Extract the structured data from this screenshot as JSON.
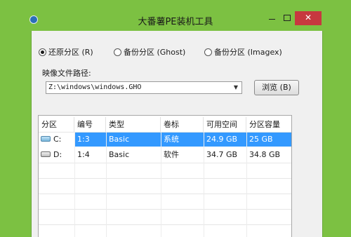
{
  "window": {
    "title": "大番薯PE装机工具",
    "close_glyph": "✕"
  },
  "mode": {
    "options": [
      {
        "label": "还原分区 (R)",
        "checked": true
      },
      {
        "label": "备份分区 (Ghost)",
        "checked": false
      },
      {
        "label": "备份分区 (Imagex)",
        "checked": false
      }
    ]
  },
  "image_path": {
    "label": "映像文件路径:",
    "value": "Z:\\windows\\windows.GHO",
    "browse_label": "浏览 (B)"
  },
  "partitions": {
    "columns": [
      "分区",
      "编号",
      "类型",
      "卷标",
      "可用空间",
      "分区容量"
    ],
    "rows": [
      {
        "drive": "C:",
        "number": "1:3",
        "type": "Basic",
        "label": "系统",
        "free": "24.9 GB",
        "capacity": "25 GB",
        "selected": true,
        "icon": "system-disk-icon"
      },
      {
        "drive": "D:",
        "number": "1:4",
        "type": "Basic",
        "label": "软件",
        "free": "34.7 GB",
        "capacity": "34.8 GB",
        "selected": false,
        "icon": "hard-disk-icon"
      }
    ]
  },
  "colors": {
    "desktop": "#7cc142",
    "selection": "#3399ff",
    "close_button": "#c7383f"
  }
}
